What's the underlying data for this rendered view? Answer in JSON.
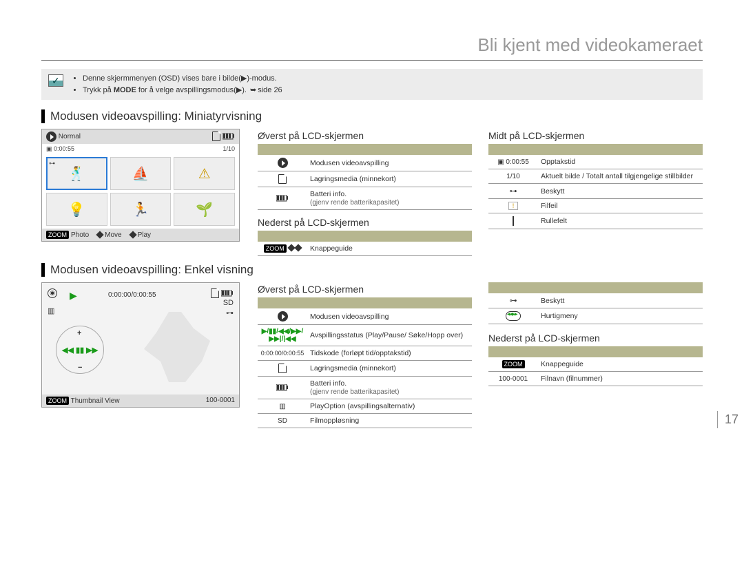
{
  "page_title": "Bli kjent med videokameraet",
  "page_number": "17",
  "note": {
    "line1_a": "Denne skjermmenyen (OSD) vises bare i bilde(",
    "line1_b": ")-modus.",
    "line2_a": "Trykk på ",
    "line2_mode": "MODE",
    "line2_b": " for å velge avspillingsmodus(",
    "line2_c": "). ",
    "line2_ref": "side 26"
  },
  "section1": {
    "heading": "Modusen videoavspilling: Miniatyrvisning",
    "lcd": {
      "normal": "Normal",
      "time": "0:00:55",
      "counter": "1/10",
      "bottom_photo": "Photo",
      "bottom_move": "Move",
      "bottom_play": "Play",
      "zoom": "ZOOM"
    },
    "top_title": "Øverst på LCD-skjermen",
    "top_rows": [
      {
        "icon": "play-circle",
        "text": "Modusen videoavspilling"
      },
      {
        "icon": "card",
        "text": "Lagringsmedia (minnekort)"
      },
      {
        "icon": "battery",
        "text": "Batteri info.",
        "sub": "(gjenv rende batterikapasitet)"
      }
    ],
    "bottom_title": "Nederst på LCD-skjermen",
    "bottom_rows": [
      {
        "icon": "zoom-diamonds",
        "text": "Knappeguide"
      }
    ],
    "mid_title": "Midt på LCD-skjermen",
    "mid_rows": [
      {
        "icon_text": "▣ 0:00:55",
        "text": "Opptakstid"
      },
      {
        "icon_text": "1/10",
        "text": "Aktuelt bilde / Totalt antall tilgjengelige stillbilder"
      },
      {
        "icon": "key",
        "text": "Beskytt"
      },
      {
        "icon": "warn",
        "text": "Filfeil"
      },
      {
        "icon": "scroll",
        "text": "Rullefelt"
      }
    ]
  },
  "section2": {
    "heading": "Modusen videoavspilling: Enkel visning",
    "lcd": {
      "time": "0:00:00/0:00:55",
      "sd": "SD",
      "bottom_left": "Thumbnail View",
      "bottom_right": "100-0001",
      "zoom": "ZOOM"
    },
    "top_title": "Øverst på LCD-skjermen",
    "top_rows": [
      {
        "icon": "play-circle",
        "text": "Modusen videoavspilling"
      },
      {
        "icon": "play-controls",
        "text": "Avspillingsstatus (Play/Pause/ Søke/Hopp over)"
      },
      {
        "icon_text": "0:00:00/0:00:55",
        "text": "Tidskode (forløpt tid/opptakstid)"
      },
      {
        "icon": "card",
        "text": "Lagringsmedia (minnekort)"
      },
      {
        "icon": "battery",
        "text": "Batteri info.",
        "sub": "(gjenv rende batterikapasitet)"
      },
      {
        "icon": "bars",
        "text": "PlayOption (avspillingsalternativ)"
      },
      {
        "icon_text": "SD",
        "text": "Filmoppløsning"
      }
    ],
    "right_top_rows": [
      {
        "icon": "key",
        "text": "Beskytt"
      },
      {
        "icon": "wheel",
        "text": "Hurtigmeny"
      }
    ],
    "bottom_title": "Nederst på LCD-skjermen",
    "bottom_rows": [
      {
        "icon": "zoom",
        "text": "Knappeguide"
      },
      {
        "icon_text": "100-0001",
        "text": "Filnavn (filnummer)"
      }
    ]
  }
}
